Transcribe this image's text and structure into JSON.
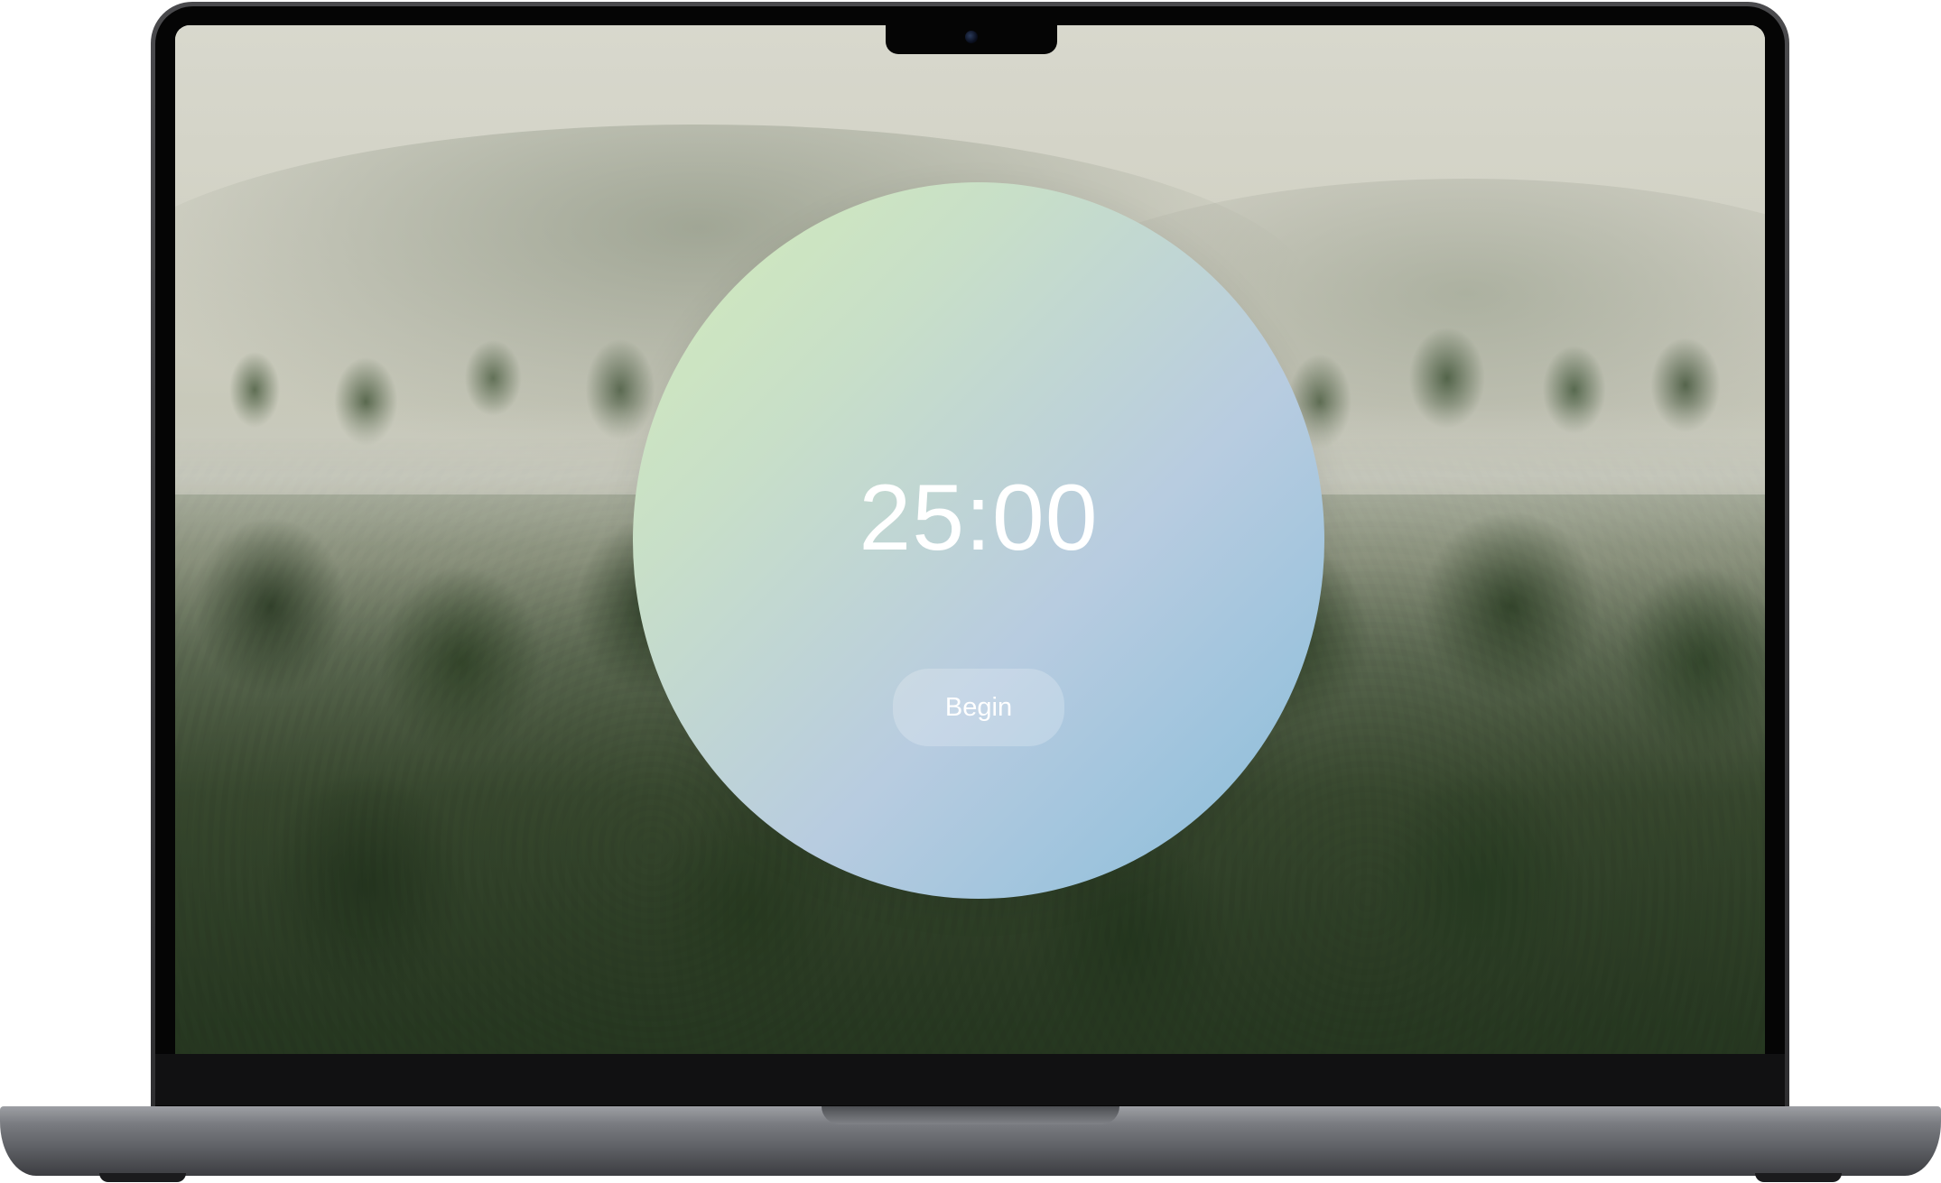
{
  "timer": {
    "time_display": "25:00",
    "begin_label": "Begin"
  },
  "colors": {
    "timer_gradient_start": "#d3ecb9",
    "timer_gradient_end": "#86bcda",
    "text": "#ffffff",
    "laptop_body": "#7a7c81"
  },
  "wallpaper": {
    "subject": "misty-forest"
  }
}
